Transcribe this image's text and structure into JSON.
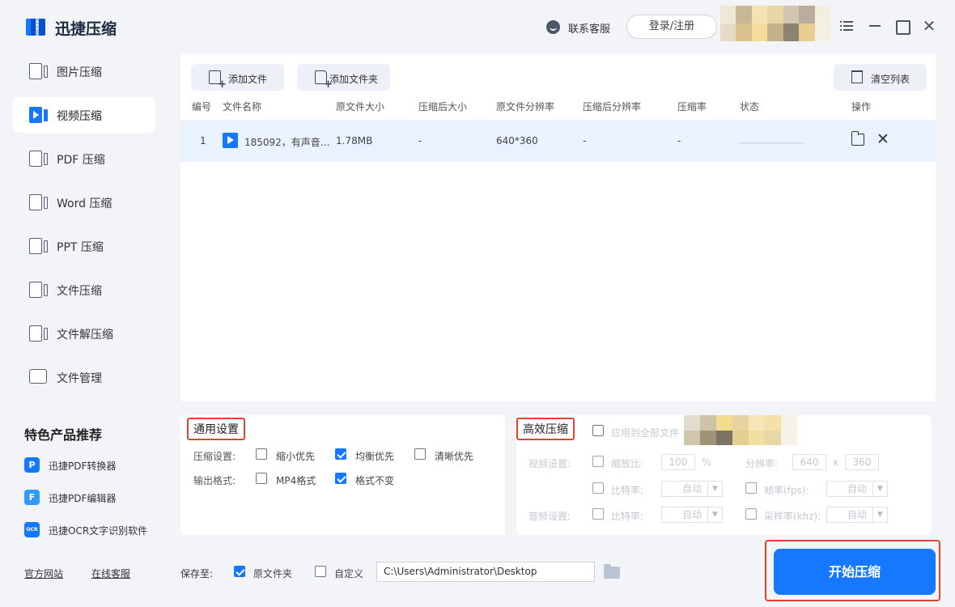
{
  "app": {
    "title": "迅捷压缩",
    "customer_service": "联系客服",
    "login": "登录/注册"
  },
  "sidebar": {
    "items": [
      {
        "label": "图片压缩",
        "icon": "image-file-icon",
        "active": false
      },
      {
        "label": "视频压缩",
        "icon": "video-file-icon",
        "active": true
      },
      {
        "label": "PDF 压缩",
        "icon": "pdf-file-icon",
        "active": false
      },
      {
        "label": "Word 压缩",
        "icon": "word-file-icon",
        "active": false
      },
      {
        "label": "PPT 压缩",
        "icon": "ppt-file-icon",
        "active": false
      },
      {
        "label": "文件压缩",
        "icon": "file-icon",
        "active": false
      },
      {
        "label": "文件解压缩",
        "icon": "unzip-file-icon",
        "active": false
      },
      {
        "label": "文件管理",
        "icon": "folder-icon",
        "active": false
      }
    ],
    "recommend_title": "特色产品推荐",
    "recommend": [
      {
        "label": "迅捷PDF转换器",
        "icon_text": "P",
        "color": "#1677ff"
      },
      {
        "label": "迅捷PDF编辑器",
        "icon_text": "F",
        "color": "#2f9bff"
      },
      {
        "label": "迅捷OCR文字识别软件",
        "icon_text": "OCR",
        "color": "#1677ff"
      }
    ],
    "links": {
      "website": "官方网站",
      "online_service": "在线客服"
    }
  },
  "toolbar": {
    "add_file": "添加文件",
    "add_folder": "添加文件夹",
    "clear_list": "清空列表"
  },
  "table": {
    "columns": [
      "编号",
      "文件名称",
      "原文件大小",
      "压缩后大小",
      "原文件分辨率",
      "压缩后分辨率",
      "压缩率",
      "状态",
      "操作"
    ],
    "rows": [
      {
        "index": "1",
        "name": "185092，有声音…",
        "orig_size": "1.78MB",
        "comp_size": "-",
        "orig_res": "640*360",
        "comp_res": "-",
        "ratio": "-"
      }
    ]
  },
  "general_settings": {
    "title": "通用设置",
    "compress_label": "压缩设置:",
    "compress_options": [
      {
        "label": "缩小优先",
        "checked": false
      },
      {
        "label": "均衡优先",
        "checked": true
      },
      {
        "label": "清晰优先",
        "checked": false
      }
    ],
    "format_label": "输出格式:",
    "format_options": [
      {
        "label": "MP4格式",
        "checked": false
      },
      {
        "label": "格式不变",
        "checked": true
      }
    ]
  },
  "efficient": {
    "title": "高效压缩",
    "apply_all": "应用到全部文件",
    "video_label": "视频设置:",
    "scale_label": "缩放比:",
    "scale_value": "100",
    "scale_unit": "%",
    "resolution_label": "分辨率:",
    "res_w": "640",
    "res_x": "x",
    "res_h": "360",
    "bitrate_label": "比特率:",
    "auto": "自动",
    "fps_label": "帧率(fps):",
    "audio_label": "音频设置:",
    "sample_label": "采样率(khz):"
  },
  "save": {
    "label": "保存至:",
    "original": "原文件夹",
    "original_checked": true,
    "custom": "自定义",
    "custom_checked": false,
    "path": "C:\\Users\\Administrator\\Desktop"
  },
  "start_button": "开始压缩",
  "colors": {
    "accent": "#1677ff",
    "highlight": "#e0442f",
    "row_bg": "#e9f2fd"
  }
}
